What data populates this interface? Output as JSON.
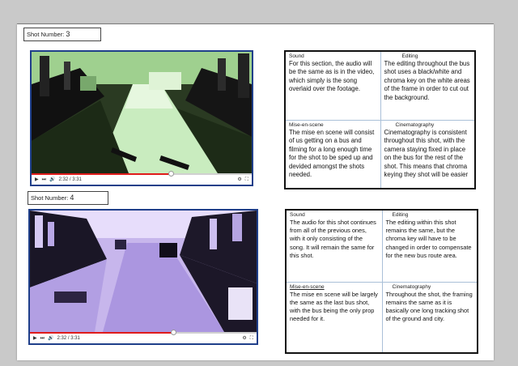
{
  "shots": [
    {
      "label": "Shot Number: ",
      "number": "3",
      "video": {
        "time": "2:32 / 3:31",
        "progress": 0.63
      },
      "notes": {
        "sound": {
          "heading": "Sound",
          "text": "For this section, the audio will be the same as is in the video, which simply is the song overlaid over the footage."
        },
        "editing": {
          "heading": "Editing",
          "text": "The editing throughout the bus shot uses a black/white and chroma key on the white areas of the frame in order to cut out the background."
        },
        "mise_en_scene": {
          "heading": "Mise-en-scene",
          "text": "The mise en scene will consist of us getting on a bus and filming for a long enough time for the shot to be sped up and devided amongst the shots needed."
        },
        "cinematography": {
          "heading": "Cinematography",
          "text": "Cinematography is consistent throughout this shot, with the camera staying fixed in place on the bus for the rest of the shot. This means that chroma keying they shot will be easier"
        }
      }
    },
    {
      "label": "Shot Number: ",
      "number": "4",
      "video": {
        "time": "2:32 / 3:31",
        "progress": 0.63
      },
      "notes": {
        "sound": {
          "heading": "Sound",
          "text": "The audio for this shot continues from all of the previous ones, with it only consisting of the song. It will remain the same for this shot."
        },
        "editing": {
          "heading": "Editing",
          "text": "The editing within this shot remains the same, but the chroma key will have to be changed in order to compensate for the new bus route area."
        },
        "mise_en_scene": {
          "heading": "Mise-en-scene",
          "text": "The mise en scene will be largely the same as the last bus shot, with the bus being the only prop needed for it."
        },
        "cinematography": {
          "heading": "Cinematography",
          "text": "Throughout the shot, the framing remains the same as it is basically one long tracking shot of the ground and city."
        }
      }
    }
  ],
  "colors": {
    "video_border": "#1f3f8a",
    "progress": "#e01b1b",
    "tint_shot3": "#8fc48a",
    "tint_shot4": "#a58fd8"
  },
  "player_icons": [
    "play-icon",
    "next-icon",
    "volume-icon",
    "settings-icon",
    "fullscreen-icon"
  ]
}
